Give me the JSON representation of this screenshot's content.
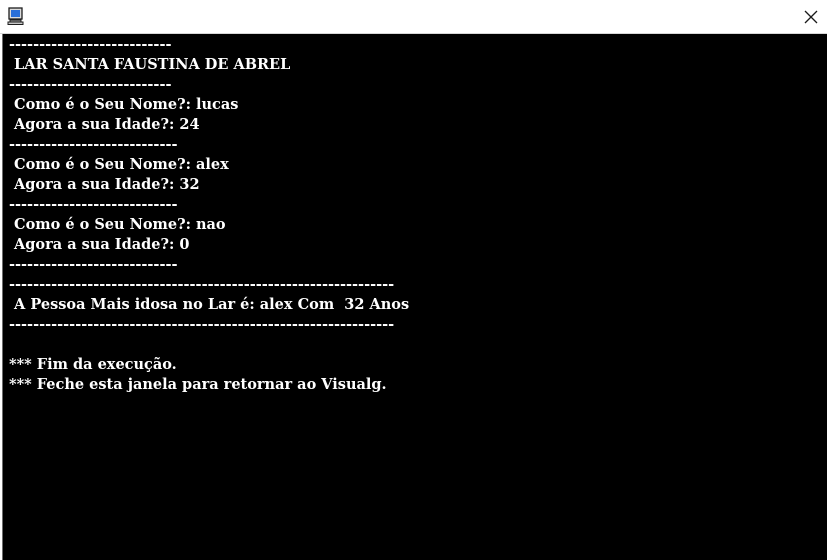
{
  "window": {
    "app_icon": "computer-icon",
    "close_icon": "close-icon"
  },
  "console": {
    "lines": [
      "---------------------------",
      " LAR SANTA FAUSTINA DE ABREL",
      "---------------------------",
      " Como é o Seu Nome?: lucas",
      " Agora a sua Idade?: 24",
      "----------------------------",
      " Como é o Seu Nome?: alex",
      " Agora a sua Idade?: 32",
      "----------------------------",
      " Como é o Seu Nome?: nao",
      " Agora a sua Idade?: 0",
      "----------------------------",
      "----------------------------------------------------------------",
      " A Pessoa Mais idosa no Lar é: alex Com  32 Anos",
      "----------------------------------------------------------------",
      "",
      "*** Fim da execução.",
      "*** Feche esta janela para retornar ao Visualg."
    ]
  }
}
